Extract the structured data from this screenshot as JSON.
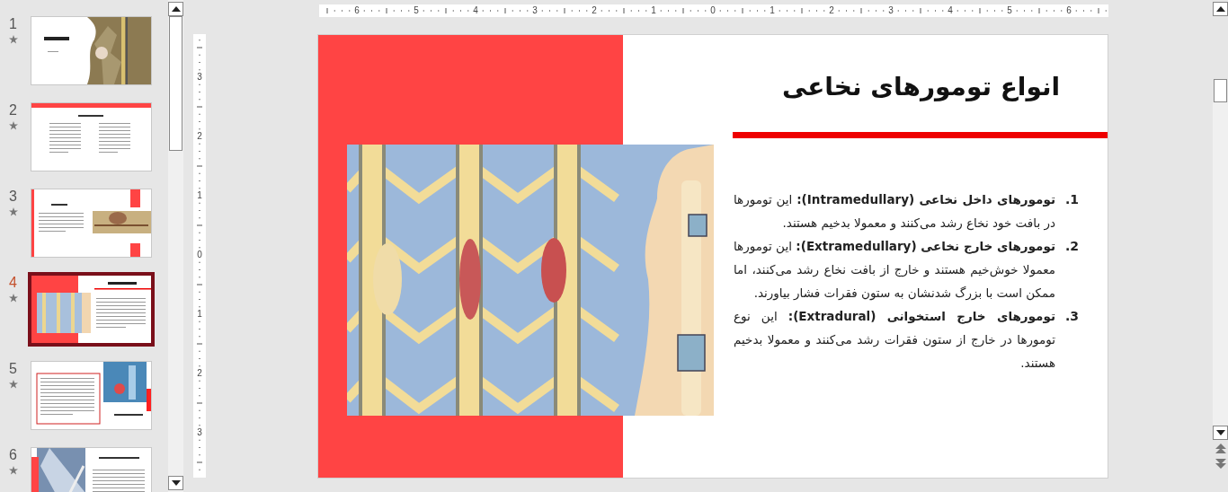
{
  "slides_panel": {
    "slides": [
      {
        "number": "1",
        "selected": false,
        "animated": true,
        "kind": "title-photo"
      },
      {
        "number": "2",
        "selected": false,
        "animated": true,
        "kind": "list"
      },
      {
        "number": "3",
        "selected": false,
        "animated": true,
        "kind": "text-photo"
      },
      {
        "number": "4",
        "selected": true,
        "animated": true,
        "kind": "split-photo"
      },
      {
        "number": "5",
        "selected": false,
        "animated": true,
        "kind": "boxed-photo"
      },
      {
        "number": "6",
        "selected": false,
        "animated": true,
        "kind": "photo-text"
      }
    ]
  },
  "rulers": {
    "horizontal": [
      "6",
      "5",
      "4",
      "3",
      "2",
      "1",
      "0",
      "1",
      "2",
      "3",
      "4",
      "5",
      "6"
    ],
    "vertical": [
      "3",
      "2",
      "1",
      "0",
      "1",
      "2",
      "3"
    ]
  },
  "slide": {
    "title": "انواع تومورهای نخاعی",
    "items": [
      {
        "number": "1.",
        "text": "**تومورهای داخل نخاعی (Intramedullary):** این تومورها در بافت خود نخاع رشد می‌کنند و معمولا بدخیم هستند."
      },
      {
        "number": "2.",
        "text": "**تومورهای خارج نخاعی (Extramedullary):** این تومورها معمولا خوش‌خیم هستند و خارج از بافت نخاع رشد می‌کنند، اما ممکن است با بزرگ شدنشان به ستون فقرات فشار بیاورند."
      },
      {
        "number": "3.",
        "text": "**تومورهای خارج استخوانی (Extradural):** این نوع تومورها در خارج از ستون فقرات رشد می‌کنند و معمولا بدخیم هستند."
      }
    ]
  }
}
